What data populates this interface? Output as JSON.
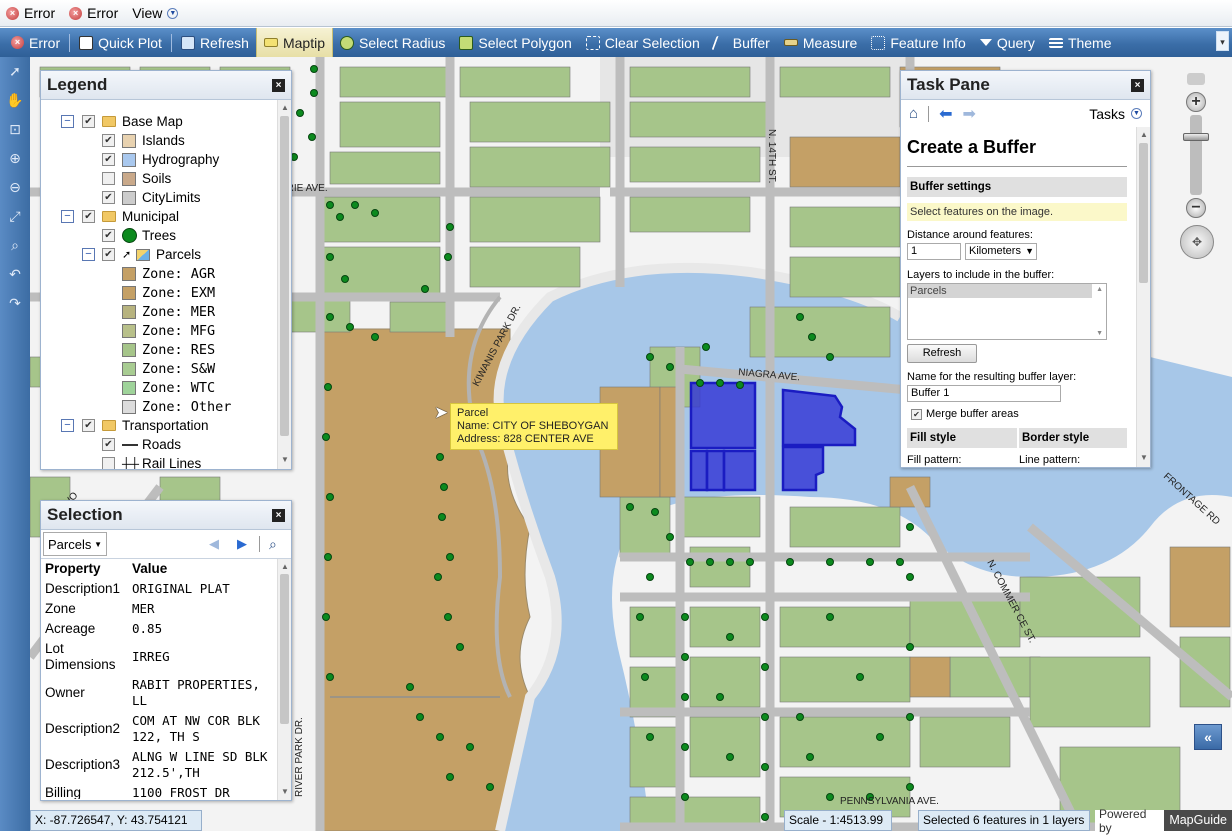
{
  "menubar": {
    "items": [
      {
        "label": "Error",
        "icon": "error-icon"
      },
      {
        "label": "Error",
        "icon": "error-icon"
      },
      {
        "label": "View",
        "icon": "dropdown-icon"
      }
    ]
  },
  "toolbar": {
    "error_label": "Error",
    "quickplot_label": "Quick Plot",
    "refresh_label": "Refresh",
    "maptip_label": "Maptip",
    "select_radius_label": "Select Radius",
    "select_polygon_label": "Select Polygon",
    "clear_selection_label": "Clear Selection",
    "buffer_label": "Buffer",
    "measure_label": "Measure",
    "feature_info_label": "Feature Info",
    "query_label": "Query",
    "theme_label": "Theme"
  },
  "legend": {
    "title": "Legend",
    "rows": [
      {
        "label": "Base Map",
        "level": 0,
        "expander": "−",
        "checked": true,
        "folder": true
      },
      {
        "label": "Islands",
        "level": 1,
        "checked": true,
        "swatch": "#e8d2b0"
      },
      {
        "label": "Hydrography",
        "level": 1,
        "checked": true,
        "swatch": "#a9c8ee"
      },
      {
        "label": "Soils",
        "level": 1,
        "checked": false,
        "swatch": "#c9a98a"
      },
      {
        "label": "CityLimits",
        "level": 1,
        "checked": true,
        "swatch": "#cccccc"
      },
      {
        "label": "Municipal",
        "level": 0,
        "expander": "−",
        "checked": true,
        "folder": true
      },
      {
        "label": "Trees",
        "level": 1,
        "checked": true,
        "swatch": "#0c8a1e",
        "round": true
      },
      {
        "label": "Parcels",
        "level": 1,
        "expander": "−",
        "checked": true,
        "select": true
      },
      {
        "label": "Zone: AGR",
        "level": 2,
        "swatch": "#c4a066"
      },
      {
        "label": "Zone: EXM",
        "level": 2,
        "swatch": "#c4a066"
      },
      {
        "label": "Zone: MER",
        "level": 2,
        "swatch": "#b7b37f"
      },
      {
        "label": "Zone: MFG",
        "level": 2,
        "swatch": "#b8c08a"
      },
      {
        "label": "Zone: RES",
        "level": 2,
        "swatch": "#a6c58a"
      },
      {
        "label": "Zone: S&W",
        "level": 2,
        "swatch": "#a8cc92"
      },
      {
        "label": "Zone: WTC",
        "level": 2,
        "swatch": "#9fd39a"
      },
      {
        "label": "Zone: Other",
        "level": 2,
        "swatch": "#dcdcdc"
      },
      {
        "label": "Transportation",
        "level": 0,
        "expander": "−",
        "checked": true,
        "folder": true
      },
      {
        "label": "Roads",
        "level": 1,
        "checked": true,
        "line": true
      },
      {
        "label": "Rail Lines",
        "level": 1,
        "checked": false,
        "rail": true
      }
    ]
  },
  "selection": {
    "title": "Selection",
    "layer": "Parcels",
    "headers": {
      "property": "Property",
      "value": "Value"
    },
    "rows": [
      {
        "property": "Description1",
        "value": "ORIGINAL PLAT"
      },
      {
        "property": "Zone",
        "value": "MER"
      },
      {
        "property": "Acreage",
        "value": "0.85"
      },
      {
        "property": "Lot Dimensions",
        "value": "IRREG"
      },
      {
        "property": "Owner",
        "value": "RABIT PROPERTIES, LL"
      },
      {
        "property": "Description2",
        "value": "COM AT NW COR BLK 122, TH S"
      },
      {
        "property": "Description3",
        "value": "ALNG W LINE SD BLK 212.5',TH"
      },
      {
        "property": "Billing",
        "value": "1100 FROST DR"
      }
    ]
  },
  "taskpane": {
    "title": "Task Pane",
    "tasks_label": "Tasks",
    "heading": "Create a Buffer",
    "buffer_settings": "Buffer settings",
    "hint": "Select features on the image.",
    "distance_label": "Distance around features:",
    "distance_value": "1",
    "units_value": "Kilometers",
    "layers_label": "Layers to include in the buffer:",
    "layers_option": "Parcels",
    "refresh_button": "Refresh",
    "name_label": "Name for the resulting buffer layer:",
    "name_value": "Buffer 1",
    "merge_label": "Merge buffer areas",
    "fill_style": "Fill style",
    "border_style": "Border style",
    "fill_pattern": "Fill pattern:",
    "line_pattern": "Line pattern:"
  },
  "map": {
    "streets": {
      "erie": "ERIE AVE.",
      "kiwanis": "KIWANIS PARK DR.",
      "n14th": "N. 14TH ST.",
      "niagra": "NIAGRA AVE.",
      "commerce": "N. COMMER CE ST.",
      "frontage": "FRONTAGE RD",
      "river_park": "RIVER PARK DR.",
      "pennsylvania": "PENNSYLVANIA AVE.",
      "wildwood": "WILDWO"
    },
    "tooltip": {
      "layer": "Parcel",
      "name_line": "Name: CITY OF SHEBOYGAN",
      "address_line": "Address: 828 CENTER AVE"
    }
  },
  "status": {
    "coords": "X: -87.726547, Y: 43.754121",
    "scale": "Scale - 1:4513.99",
    "selected": "Selected 6 features in 1 layers",
    "powered_by": "Powered by",
    "brand": "MapGuide"
  },
  "colors": {
    "toolbar": "#3b6ea8",
    "water": "#a7c7e8",
    "parcel_res": "#a6c58a",
    "parcel_agr": "#c4a066",
    "tree": "#0c8a1e",
    "selected": "#3336d6"
  }
}
